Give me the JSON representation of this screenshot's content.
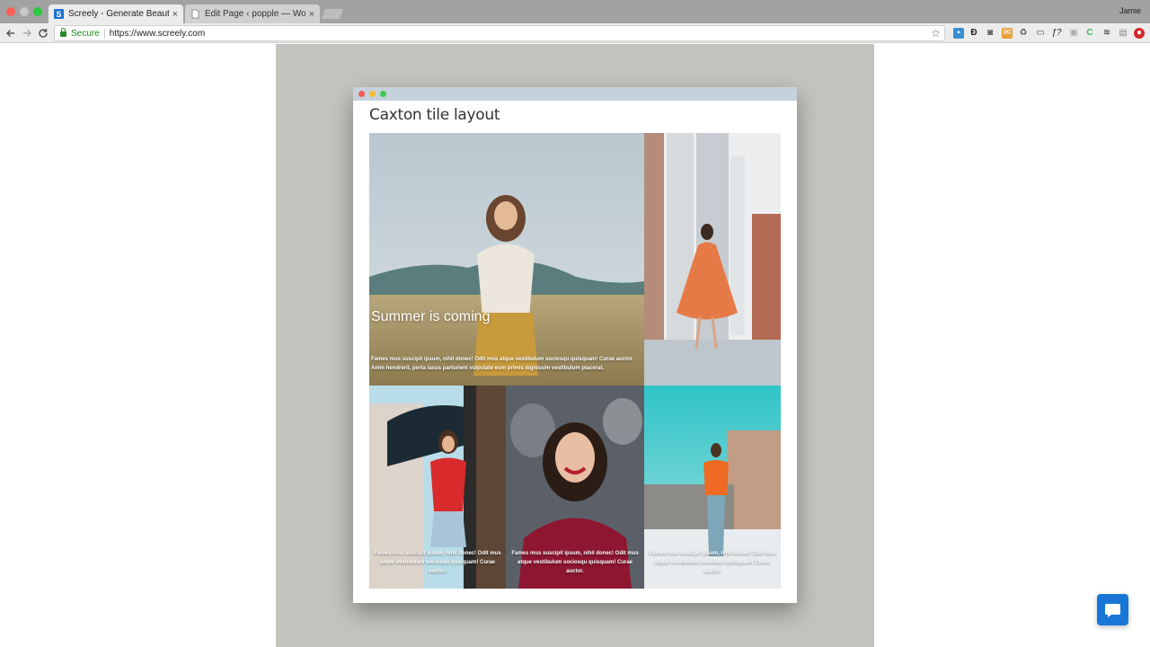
{
  "browser": {
    "tabs": [
      {
        "title": "Screely - Generate Beautiful M",
        "active": true,
        "favicon": "s-favicon"
      },
      {
        "title": "Edit Page ‹ popple — WordPre",
        "active": false,
        "favicon": "page-icon"
      }
    ],
    "close_glyph": "×",
    "profile_name": "Jamie",
    "secure_label": "Secure",
    "url": "https://www.screely.com",
    "extensions": [
      "ext-badge-icon",
      "ext-d-icon",
      "ext-camera-icon",
      "ext-mail-icon",
      "ext-recycle-icon",
      "ext-cast-icon",
      "ext-fx-icon",
      "ext-bag-icon",
      "ext-c-icon",
      "ext-layers-icon",
      "ext-window-icon",
      "ext-stop-icon"
    ]
  },
  "mockup": {
    "heading": "Caxton tile layout",
    "tiles": [
      {
        "title": "Summer is coming",
        "text": "Fames mus suscipit ipsum, nihil donec! Odit mus atque vestibulum sociosqu quisquam! Curae auctor. Anim hendrerit, porta lacus parturient vulputate eum primis dignissim vestibulum placerat."
      },
      {
        "title": "",
        "text": ""
      },
      {
        "title": "",
        "text": "Fames mus suscipit ipsum, nihil donec! Odit mus atque vestibulum sociosqu quisquam! Curae auctor."
      },
      {
        "title": "",
        "text": "Fames mus suscipit ipsum, nihil donec! Odit mus atque vestibulum sociosqu quisquam! Curae auctor."
      },
      {
        "title": "",
        "text": "Fames mus suscipit ipsum, nihil donec! Odit mus atque vestibulum sociosqu quisquam! Curae auctor."
      }
    ]
  },
  "colors": {
    "stage": "#c3c4bd",
    "chat_button": "#1877d6",
    "secure_green": "#1f8a1f"
  }
}
